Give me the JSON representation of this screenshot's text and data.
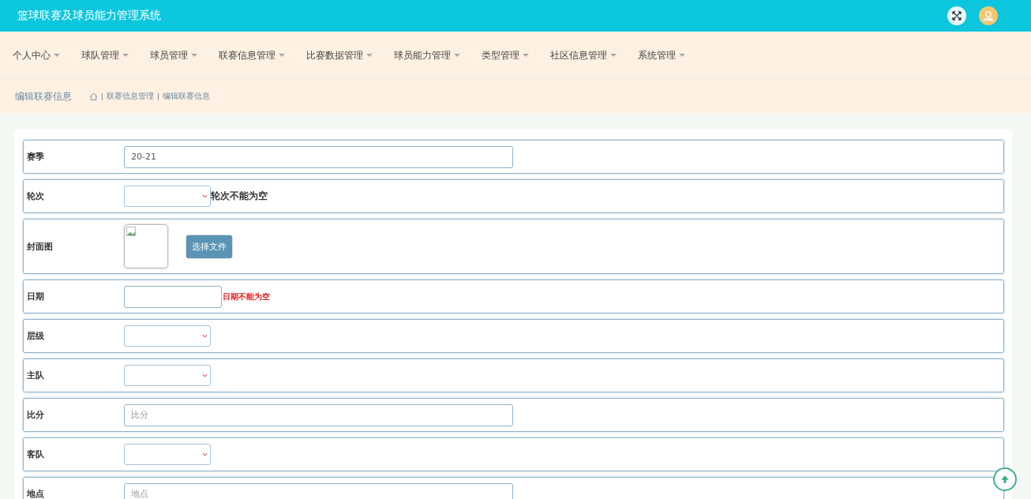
{
  "header": {
    "title": "篮球联赛及球员能力管理系统"
  },
  "nav": [
    {
      "label": "个人中心"
    },
    {
      "label": "球队管理"
    },
    {
      "label": "球员管理"
    },
    {
      "label": "联赛信息管理"
    },
    {
      "label": "比赛数据管理"
    },
    {
      "label": "球员能力管理"
    },
    {
      "label": "类型管理"
    },
    {
      "label": "社区信息管理"
    },
    {
      "label": "系统管理"
    }
  ],
  "breadcrumb": {
    "page_title": "编辑联赛信息",
    "trail": [
      "联赛信息管理",
      "编辑联赛信息"
    ]
  },
  "form": [
    {
      "label": "赛季",
      "kind": "text",
      "value": "20-21"
    },
    {
      "label": "轮次",
      "kind": "select",
      "error": {
        "text": "轮次不能为空",
        "color": "#333333"
      }
    },
    {
      "label": "封面图",
      "kind": "image",
      "button": "选择文件"
    },
    {
      "label": "日期",
      "kind": "date",
      "error": {
        "text": "日期不能为空",
        "color": "#e0201c"
      }
    },
    {
      "label": "层级",
      "kind": "select"
    },
    {
      "label": "主队",
      "kind": "select"
    },
    {
      "label": "比分",
      "kind": "text",
      "placeholder": "比分"
    },
    {
      "label": "客队",
      "kind": "select"
    },
    {
      "label": "地点",
      "kind": "text",
      "placeholder": "地点"
    }
  ]
}
